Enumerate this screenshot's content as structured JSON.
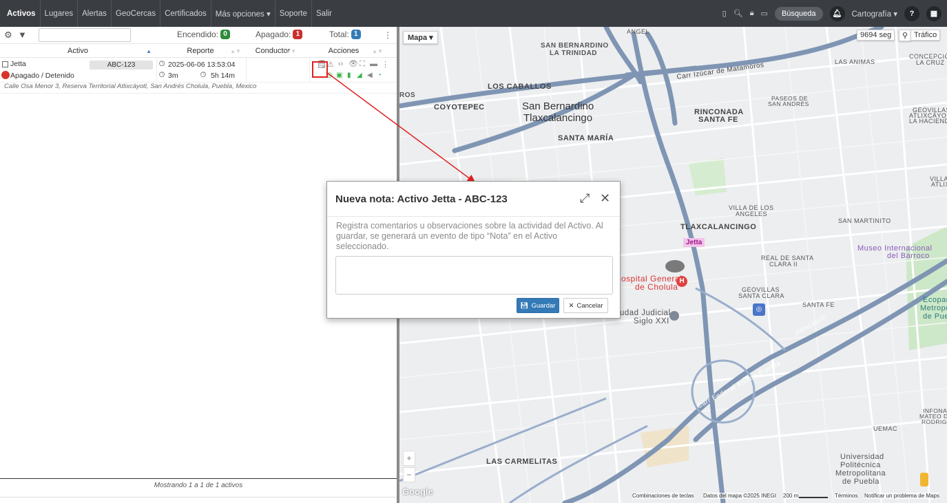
{
  "nav": {
    "items": [
      "Activos",
      "Lugares",
      "Alertas",
      "GeoCercas",
      "Certificados",
      "Más opciones ▾",
      "Soporte",
      "Salir"
    ],
    "search_label": "Búsqueda",
    "cartography_label": "Cartografía ▾",
    "help_icon": "?"
  },
  "toolbar": {
    "encendido_label": "Encendido:",
    "encendido_count": "0",
    "apagado_label": "Apagado:",
    "apagado_count": "1",
    "total_label": "Total:",
    "total_count": "1"
  },
  "table": {
    "headers": [
      "Activo",
      "Reporte",
      "Conductor",
      "Acciones"
    ],
    "rows": [
      {
        "name": "Jetta",
        "plate": "ABC-123",
        "status": "Apagado / Detenido",
        "report_datetime": "2025-06-06 13:53:04",
        "report_ago": "3m",
        "report_duration": "5h 14m",
        "address": "Calle Osa Menor 3, Reserva Territorial Atlixcáyotl, San Andrés Cholula, Puebla, Mexico"
      }
    ],
    "footer": "Mostrando 1 a 1 de 1 activos"
  },
  "map": {
    "type_label": "Mapa ▾",
    "seconds_label": "9694 seg",
    "traffic_label": "Tráfico",
    "labels": {
      "san_bernardino": "San Bernardino",
      "tlaxcalancingo_city": "Tlaxcalancingo",
      "san_bernardino_trinidad_1": "SAN BERNARDINO",
      "san_bernardino_trinidad_2": "LA TRINIDAD",
      "los_caballos": "LOS CABALLOS",
      "coyotepec": "COYOTEPEC",
      "santa_maria": "SANTA MARÍA",
      "rinconada_1": "RINCONADA",
      "rinconada_2": "SANTA FE",
      "tlaxcalancingo": "TLAXCALANCINGO",
      "villa_de_los_angeles_1": "VILLA DE LOS",
      "villa_de_los_angeles_2": "ANGELES",
      "real_de_santa_clara_1": "REAL DE SANTA",
      "real_de_santa_clara_2": "CLARA II",
      "geovillas_santa_clara_1": "GEOVILLAS",
      "geovillas_santa_clara_2": "SANTA CLARA",
      "santa_fe": "SANTA FE",
      "san_martinito": "SAN MARTINITO",
      "las_animas": "LAS ANIMAS",
      "concepcion_1": "CONCEPCIÓN",
      "concepcion_2": "LA CRUZ",
      "paseos_1": "PASEOS DE",
      "paseos_2": "SAN ANDRÉS",
      "geovillas_hacienda_1": "GEOVILLAS",
      "geovillas_hacienda_2": "ATLIXCÁYOTL",
      "geovillas_hacienda_3": "LA HACIENDA",
      "las_carmelitas": "LAS CARMELITAS",
      "uemac": "UEMAC",
      "hospital_1": "ospital General",
      "hospital_2": "de Cholula",
      "ciudad_judicial_1": "udad Judicial",
      "ciudad_judicial_2": "Siglo XXI",
      "museo_1": "Museo Internacional",
      "museo_2": "del Barroco",
      "ecoparque_1": "Ecoparq",
      "ecoparque_2": "Metropoli",
      "ecoparque_3": "de Puebl",
      "universidad_1": "Universidad",
      "universidad_2": "Politécnica",
      "universidad_3": "Metropolitana",
      "universidad_4": "de Puebla",
      "jetta_marker": "Jetta",
      "carr_izucar": "Carr Izúcar de Matamoros",
      "atlixcayotl": "Atlixcáyotl",
      "carr_federal": "Carr Federal Atlixco-Puebla",
      "ros": "ROS",
      "villas_1": "VILLAS",
      "villas_2": "ATLIX",
      "infonavit_1": "INFONAVI",
      "infonavit_2": "MATEO DE L",
      "infonavit_3": "RODRIGUE",
      "angel": "ANGEL"
    },
    "attribution": {
      "shortcuts": "Combinaciones de teclas",
      "data": "Datos del mapa ©2025 INEGI",
      "scale": "200 m",
      "terms": "Términos",
      "report": "Notificar un problema de Maps",
      "google": "Google"
    }
  },
  "modal": {
    "title": "Nueva nota: Activo Jetta - ABC-123",
    "description": "Registra comentarios u observaciones sobre la actividad del Activo. Al guardar, se generará un evento de tipo “Nota” en el Activo seleccionado.",
    "save_label": "Guardar",
    "cancel_label": "Cancelar"
  },
  "colors": {
    "nav_bg": "#3a3d42",
    "encendido": "#2e8b3a",
    "apagado": "#c9302c",
    "total": "#337ab7",
    "primary": "#337ab7"
  }
}
